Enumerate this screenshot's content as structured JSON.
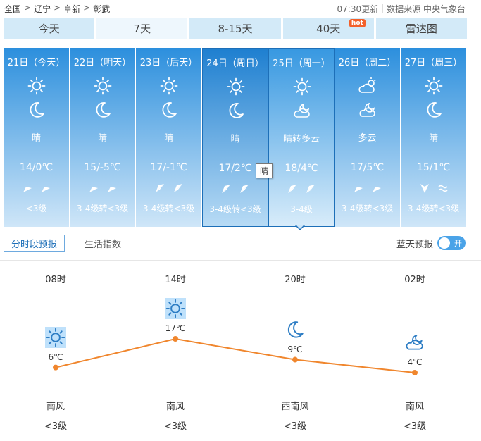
{
  "breadcrumb": {
    "items": [
      "全国",
      "辽宁",
      "阜新",
      "彰武"
    ],
    "sep": ">"
  },
  "header": {
    "update": "07:30更新",
    "source": "数据来源 中央气象台"
  },
  "tabs": [
    {
      "label": "今天",
      "hot": ""
    },
    {
      "label": "7天",
      "hot": ""
    },
    {
      "label": "8-15天",
      "hot": ""
    },
    {
      "label": "40天",
      "hot": "hot"
    },
    {
      "label": "雷达图",
      "hot": ""
    }
  ],
  "days": [
    {
      "date": "21日（今天）",
      "icon_day": "sun-icon",
      "icon_night": "moon-icon",
      "weather": "晴",
      "temp": "14/0℃",
      "wind1": "northeast-arrow-icon",
      "wind2": "northeast-arrow-icon",
      "level": "<3级"
    },
    {
      "date": "22日（明天）",
      "icon_day": "sun-icon",
      "icon_night": "moon-icon",
      "weather": "晴",
      "temp": "15/-5℃",
      "wind1": "northeast-arrow-icon",
      "wind2": "northeast-arrow-icon",
      "level": "3-4级转<3级"
    },
    {
      "date": "23日（后天）",
      "icon_day": "sun-icon",
      "icon_night": "moon-icon",
      "weather": "晴",
      "temp": "17/-1℃",
      "wind1": "southwest-arrow-icon",
      "wind2": "southwest-arrow-icon",
      "level": "3-4级转<3级"
    },
    {
      "date": "24日（周日）",
      "icon_day": "sun-icon",
      "icon_night": "moon-icon",
      "weather": "晴",
      "temp": "17/2℃",
      "wind1": "southwest-arrow-icon",
      "wind2": "southwest-arrow-icon",
      "level": "3-4级转<3级"
    },
    {
      "date": "25日（周一）",
      "icon_day": "sun-icon",
      "icon_night": "cloud-moon-icon",
      "weather": "晴转多云",
      "temp": "18/4℃",
      "wind1": "southwest-arrow-icon",
      "wind2": "southwest-arrow-icon",
      "level": "3-4级"
    },
    {
      "date": "26日（周二）",
      "icon_day": "cloud-sun-icon",
      "icon_night": "cloud-moon-icon",
      "weather": "多云",
      "temp": "17/5℃",
      "wind1": "northeast-arrow-icon",
      "wind2": "northeast-arrow-icon",
      "level": "3-4级转<3级"
    },
    {
      "date": "27日（周三）",
      "icon_day": "sun-icon",
      "icon_night": "moon-icon",
      "weather": "晴",
      "temp": "15/1℃",
      "wind1": "south-arrow-icon",
      "wind2": "variable-wind-icon",
      "level": "3-4级转<3级"
    }
  ],
  "tooltip": "晴",
  "subtabs": {
    "hourly": "分时段预报",
    "index": "生活指数",
    "bluesky": "蓝天预报",
    "toggle": "开"
  },
  "hourly": [
    {
      "time": "08时",
      "icon": "sun-icon",
      "temp_c": 6,
      "temp": "6℃",
      "wind_dir": "南风",
      "wind_level": "<3级"
    },
    {
      "time": "14时",
      "icon": "sun-icon",
      "temp_c": 17,
      "temp": "17℃",
      "wind_dir": "南风",
      "wind_level": "<3级"
    },
    {
      "time": "20时",
      "icon": "moon-icon",
      "temp_c": 9,
      "temp": "9℃",
      "wind_dir": "西南风",
      "wind_level": "<3级"
    },
    {
      "time": "02时",
      "icon": "cloud-moon-icon",
      "temp_c": 4,
      "temp": "4℃",
      "wind_dir": "南风",
      "wind_level": "<3级"
    }
  ],
  "colors": {
    "accent": "#1d6fb8",
    "line": "#f0862d",
    "tab_bg": "#d3eaf8",
    "hot": "#f3602a"
  }
}
